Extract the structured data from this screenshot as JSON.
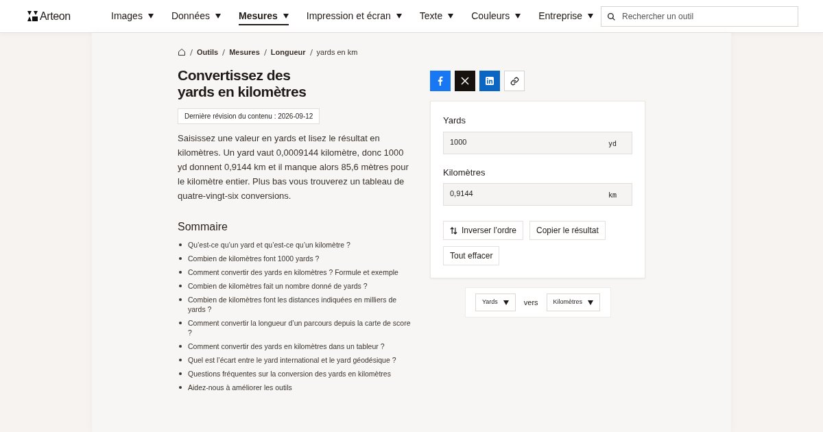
{
  "header": {
    "logo": "Arteon",
    "nav": [
      {
        "label": "Images",
        "selected": false
      },
      {
        "label": "Données",
        "selected": false
      },
      {
        "label": "Mesures",
        "selected": true
      },
      {
        "label": "Impression et écran",
        "selected": false
      },
      {
        "label": "Texte",
        "selected": false
      },
      {
        "label": "Couleurs",
        "selected": false
      },
      {
        "label": "Entreprise",
        "selected": false
      }
    ],
    "search": {
      "placeholder": "Rechercher un outil"
    }
  },
  "breadcrumb": [
    "Outils",
    "Mesures",
    "Longueur",
    "yards en km"
  ],
  "title": "Convertissez des yards en kilomètres",
  "revision": "Dernière révision du contenu : 2026-09-12",
  "intro": "Saisissez une valeur en yards et lisez le résultat en kilomètres. Un yard vaut 0,0009144 kilomètre, donc 1000 yd donnent 0,9144 km et il manque alors 85,6 mètres pour le kilomètre entier. Plus bas vous trouverez un tableau de quatre-vingt-six conversions.",
  "summary": {
    "heading": "Sommaire",
    "items": [
      "Qu’est-ce qu’un yard et qu’est-ce qu’un kilomètre ?",
      "Combien de kilomètres font 1000 yards ?",
      "Comment convertir des yards en kilomètres ? Formule et exemple",
      "Combien de kilomètres fait un nombre donné de yards ?",
      "Combien de kilomètres font les distances indiquées en milliers de yards ?",
      "Comment convertir la longueur d’un parcours depuis la carte de score ?",
      "Comment convertir des yards en kilomètres dans un tableur ?",
      "Quel est l’écart entre le yard international et le yard géodésique ?",
      "Questions fréquentes sur la conversion des yards en kilomètres",
      "Aidez-nous à améliorer les outils"
    ]
  },
  "share": [
    {
      "kind": "facebook"
    },
    {
      "kind": "x"
    },
    {
      "kind": "linkedin"
    },
    {
      "kind": "link"
    }
  ],
  "converter": {
    "fields": [
      {
        "label": "Yards",
        "value": "1000",
        "unit": "yd"
      },
      {
        "label": "Kilomètres",
        "value": "0,9144",
        "unit": "km"
      }
    ],
    "buttons": [
      {
        "label": "Inverser l’ordre",
        "kind": "swap"
      },
      {
        "label": "Copier le résultat",
        "kind": "plain"
      },
      {
        "label": "Tout effacer",
        "kind": "plain"
      }
    ]
  },
  "units": {
    "from": "Yards",
    "joiner": "vers",
    "to": "Kilomètres"
  }
}
